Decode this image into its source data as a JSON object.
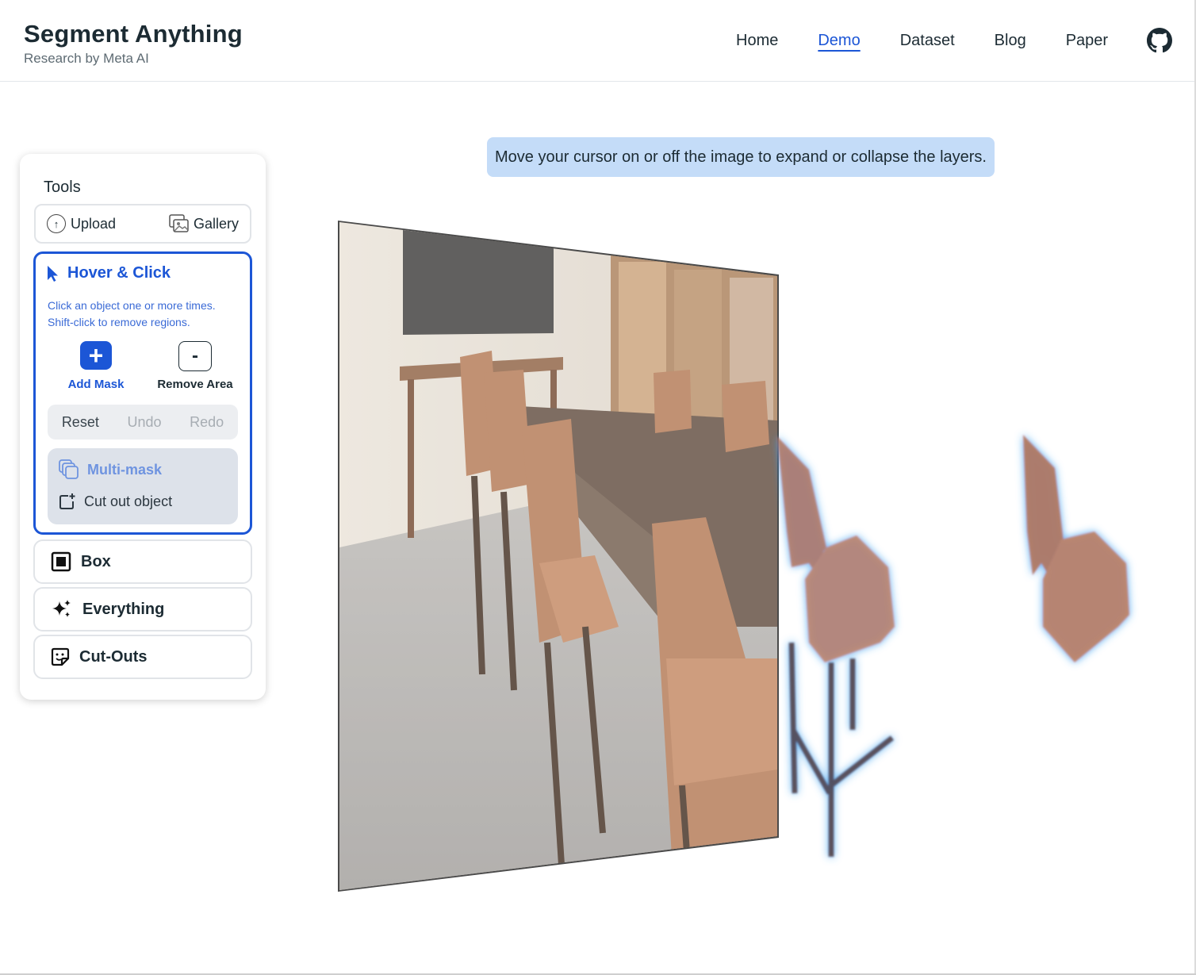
{
  "brand": {
    "title": "Segment Anything",
    "subtitle": "Research by Meta AI"
  },
  "nav": {
    "items": [
      {
        "label": "Home",
        "active": false
      },
      {
        "label": "Demo",
        "active": true
      },
      {
        "label": "Dataset",
        "active": false
      },
      {
        "label": "Blog",
        "active": false
      },
      {
        "label": "Paper",
        "active": false
      }
    ],
    "github_icon": "github-icon"
  },
  "tools": {
    "title": "Tools",
    "upload_label": "Upload",
    "gallery_label": "Gallery",
    "hover_click": {
      "title": "Hover & Click",
      "desc_line1": "Click an object one or more times.",
      "desc_line2": "Shift-click to remove regions.",
      "add_mask_label": "Add Mask",
      "remove_area_label": "Remove Area",
      "reset_label": "Reset",
      "undo_label": "Undo",
      "redo_label": "Redo",
      "multimask_label": "Multi-mask",
      "cutout_label": "Cut out object"
    },
    "box_label": "Box",
    "everything_label": "Everything",
    "cutouts_label": "Cut-Outs"
  },
  "banner": {
    "text": "Move your cursor on or off the image to expand or collapse the layers."
  },
  "colors": {
    "accent": "#1c56d6",
    "banner_bg": "#c4dcf8",
    "mask_glow": "#3aa0f0"
  }
}
